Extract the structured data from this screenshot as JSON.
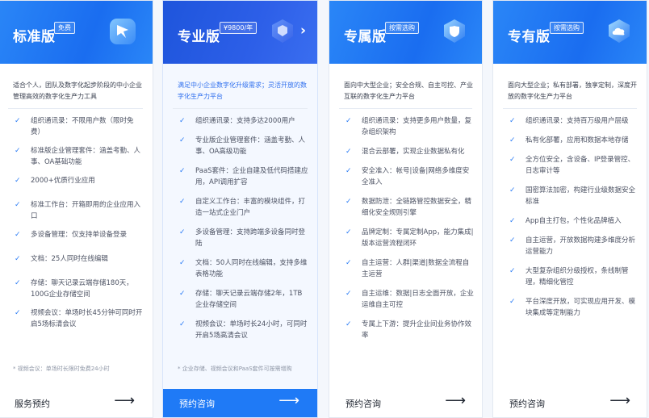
{
  "colors": {
    "accent": "#1f7af6",
    "check": "#2b7cf5",
    "header_blue": "#1a6df0",
    "pro_header": "#1e55dc"
  },
  "plans": [
    {
      "title": "标准版",
      "badge": "免费",
      "icon": "bird-icon",
      "description": "适合个人，团队及数字化起步阶段的中小企业管理高效的数字化生产力工具",
      "features": [
        "组织通讯录：不限用户数（限时免费）",
        "标准版企业管理套件：涵盖考勤、人事、OA基础功能",
        "2000+优质行业应用",
        "标准工作台：开箱即用的企业应用入口",
        "多设备管理：仅支持单设备登录",
        "文档：25人同时在线编辑",
        "存储：聊天记录云端存储180天，100G企业存储空间",
        "视频会议：单场时长45分钟可同时开启5场标清会议"
      ],
      "note": "* 视频会议：单场时长限时免费24小时",
      "cta": "服务预约"
    },
    {
      "title": "专业版",
      "badge": "¥9800/年",
      "icon": "shield-icon",
      "description": "满足中小企业数字化升级需求；灵活开放的数字化生产力平台",
      "features": [
        "组织通讯录：支持多达2000用户",
        "专业版企业管理套件：涵盖考勤、人事、OA高级功能",
        "PaaS套件：企业自建及低代码搭建应用，API调用扩容",
        "自定义工作台：丰富的模块组件，打造一站式企业门户",
        "多设备管理：支持跨端多设备同时登陆",
        "文档：50人同时在线编辑，支持多维表格功能",
        "存储：聊天记录云端存储2年，1TB企业存储空间",
        "视频会议：单场时长24小时，可同时开启5场高清会议"
      ],
      "note": "* 企业存储、视频会议和PaaS套件可按需增购",
      "cta": "预约咨询"
    },
    {
      "title": "专属版",
      "badge": "按需选购",
      "icon": "security-shield-icon",
      "description": "面向中大型企业；安全合规、自主可控、产业互联的数字化生产力平台",
      "features": [
        "组织通讯录：支持更多用户数量，复杂组织架构",
        "混合云部署，实现企业数据私有化",
        "安全准入：帐号|设备|网络多维度安全准入",
        "数据防泄：全链路管控数据安全，精细化安全规则引擎",
        "品牌定制：专属定制App，能力集成|版本运营流程闭环",
        "自主运营：人群|渠道|数据全流程自主运营",
        "自主运维：数据|日志全面开放，企业运维自主可控",
        "专属上下游：提升企业间业务协作效率"
      ],
      "note": "",
      "cta": "预约咨询"
    },
    {
      "title": "专有版",
      "badge": "按需选购",
      "icon": "cloud-icon",
      "description": "面向大型企业；私有部署，独享定制，深度开放的数字化生产力平台",
      "features": [
        "组织通讯录：支持百万级用户层级",
        "私有化部署，应用和数据本地存储",
        "全方位安全，含设备、IP登录管控、日志审计等",
        "国密算法加密，构建行业级数据安全标准",
        "App自主打包，个性化品牌植入",
        "自主运营，开放数据构建多维度分析运营能力",
        "大型复杂组织分级授权，条线制管理，精细化管控",
        "平台深度开放，可实现应用开发、模块集成等定制能力"
      ],
      "note": "",
      "cta": "预约咨询"
    }
  ]
}
